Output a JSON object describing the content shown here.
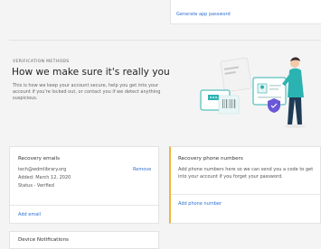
{
  "top": {
    "generate_app_password": "Generate app password"
  },
  "verification": {
    "eyebrow": "VERIFICATION METHODS",
    "headline": "How we make sure it's really you",
    "description": "This is how we keep your account secure, help you get into your account if you're locked out, or contact you if we detect anything suspicious."
  },
  "recovery_emails": {
    "title": "Recovery emails",
    "email": "tech@wdmlibrary.org",
    "added": "Added: March 12, 2020",
    "status": "Status - Verified",
    "remove": "Remove",
    "add": "Add email"
  },
  "recovery_phones": {
    "title": "Recovery phone numbers",
    "description": "Add phone numbers here so we can send you a code to get into your account if you forget your password.",
    "add": "Add phone number"
  },
  "device_notifications": {
    "title": "Device Notifications"
  },
  "colors": {
    "link": "#2f6fd1",
    "accent": "#f0b63f",
    "teal": "#2bb3b1",
    "shield": "#6b57d8"
  }
}
